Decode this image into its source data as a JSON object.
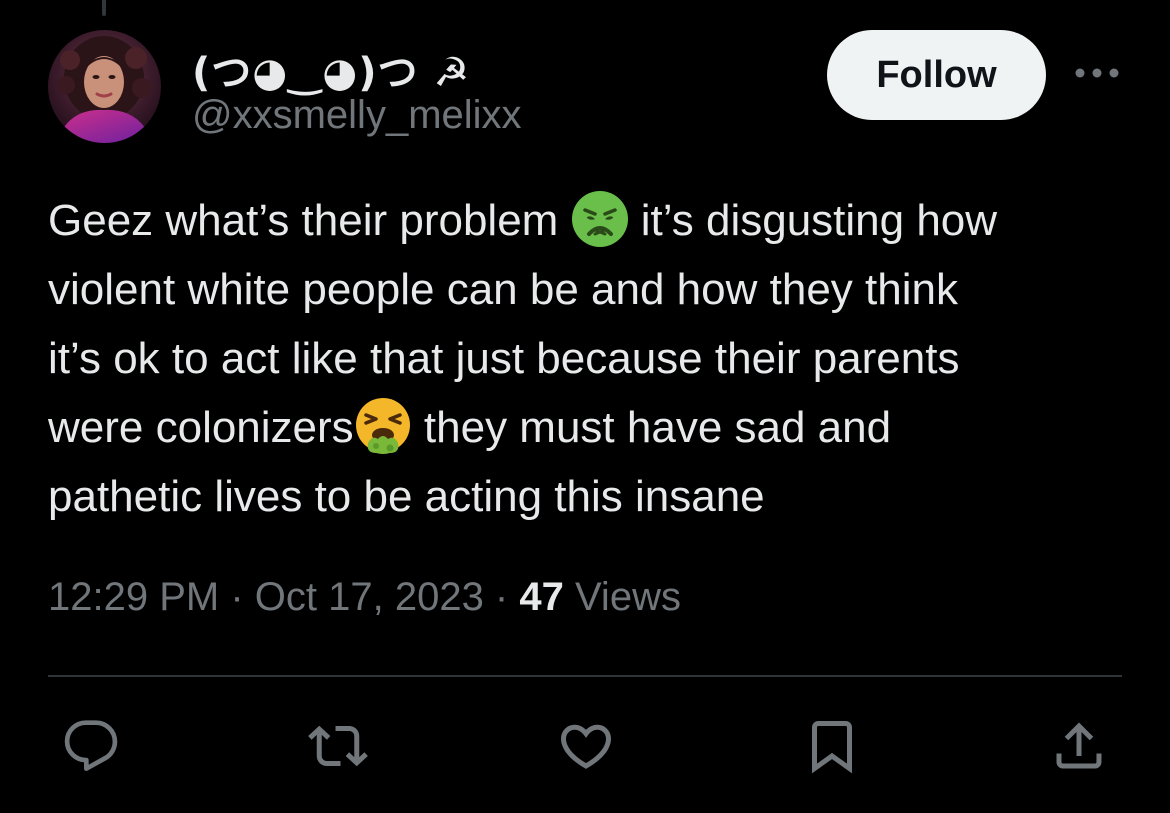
{
  "user": {
    "display_name": "(つ◕‿◕)つ ☭",
    "handle": "@xxsmelly_melixx"
  },
  "follow_label": "Follow",
  "tweet": {
    "lines": [
      [
        "Geez what’s their problem ",
        "sick-face-emoji",
        " it’s disgusting how"
      ],
      [
        "violent white people can be and how they think"
      ],
      [
        "it’s ok to act like that just because their parents"
      ],
      [
        "were colonizers",
        "vomiting-face-emoji",
        " they must have sad and"
      ],
      [
        "pathetic lives to be acting this insane"
      ]
    ]
  },
  "meta": {
    "time": "12:29 PM",
    "separator": " · ",
    "date": "Oct 17, 2023",
    "views_count": "47",
    "views_label": " Views"
  },
  "actions": [
    "reply-icon",
    "retweet-icon",
    "like-icon",
    "bookmark-icon",
    "share-icon"
  ],
  "colors": {
    "background": "#000000",
    "primary_text": "#e7e9ea",
    "secondary_text": "#71767b",
    "follow_bg": "#eff3f4",
    "divider": "#2f3336",
    "emoji_green": "#6abf4b"
  }
}
